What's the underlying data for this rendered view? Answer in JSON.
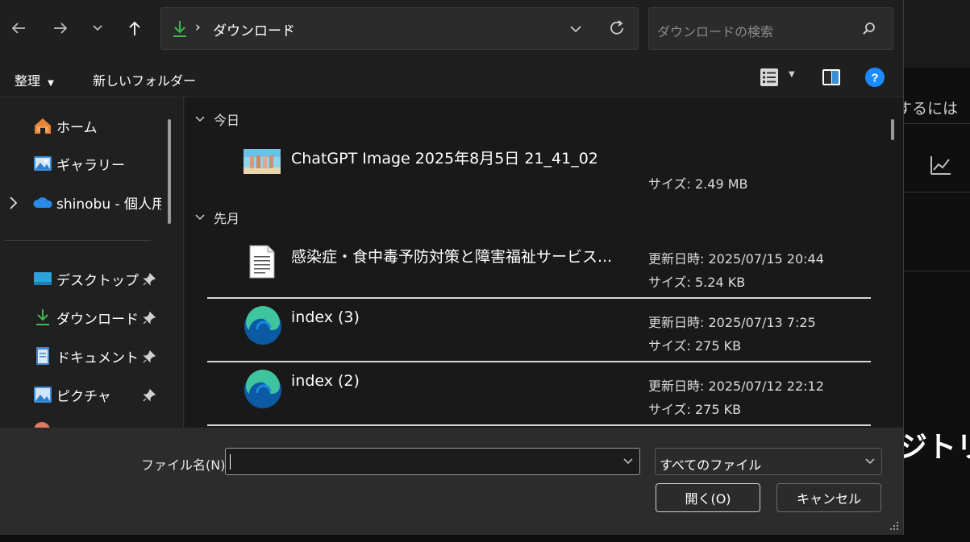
{
  "address_bar": {
    "path": "ダウンロード"
  },
  "search": {
    "placeholder": "ダウンロードの検索"
  },
  "command_bar": {
    "organize": "整理",
    "new_folder": "新しいフォルダー"
  },
  "nav_pane": {
    "items": [
      {
        "label": "ホーム",
        "icon": "home-icon"
      },
      {
        "label": "ギャラリー",
        "icon": "gallery-icon"
      },
      {
        "label": "shinobu - 個人用",
        "icon": "onedrive-icon"
      }
    ],
    "pinned": [
      {
        "label": "デスクトップ",
        "icon": "desktop-icon"
      },
      {
        "label": "ダウンロード",
        "icon": "download-icon"
      },
      {
        "label": "ドキュメント",
        "icon": "document-icon"
      },
      {
        "label": "ピクチャ",
        "icon": "pictures-icon"
      }
    ]
  },
  "file_list": {
    "groups": [
      {
        "header": "今日",
        "files": [
          {
            "name": "ChatGPT Image 2025年8月5日 21_41_02",
            "modified": "",
            "size": "サイズ: 2.49 MB",
            "icon": "image-thumbnail"
          }
        ]
      },
      {
        "header": "先月",
        "files": [
          {
            "name": "感染症・食中毒予防対策と障害福祉サービス...",
            "modified": "更新日時: 2025/07/15 20:44",
            "size": "サイズ: 5.24 KB",
            "icon": "text-file-icon"
          },
          {
            "name": "index (3)",
            "modified": "更新日時: 2025/07/13 7:25",
            "size": "サイズ: 275 KB",
            "icon": "edge-icon"
          },
          {
            "name": "index (2)",
            "modified": "更新日時: 2025/07/12 22:12",
            "size": "サイズ: 275 KB",
            "icon": "edge-icon"
          }
        ]
      }
    ]
  },
  "footer": {
    "filename_label": "ファイル名(N):",
    "filename_value": "",
    "file_type": "すべてのファイル",
    "open_button": "開く(O)",
    "cancel_button": "キャンセル"
  },
  "background_app": {
    "hint_text": "するには",
    "big_text": "ジトリ"
  },
  "colors": {
    "accent": "#0078d4",
    "download_green": "#3fb950",
    "help_blue": "#1a8cff"
  }
}
